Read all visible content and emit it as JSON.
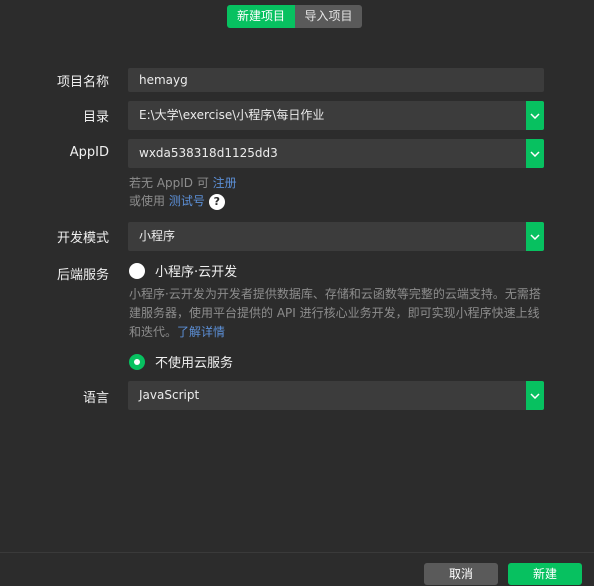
{
  "tabs": {
    "new_project": "新建项目",
    "import_project": "导入项目"
  },
  "form": {
    "project_name": {
      "label": "项目名称",
      "value": "hemayg"
    },
    "directory": {
      "label": "目录",
      "value": "E:\\大学\\exercise\\小程序\\每日作业"
    },
    "appid": {
      "label": "AppID",
      "value": "wxda538318d1125dd3",
      "hint_prefix": "若无 AppID 可 ",
      "hint_register": "注册",
      "hint2_prefix": "或使用 ",
      "hint2_test": "测试号",
      "help": "?"
    },
    "dev_mode": {
      "label": "开发模式",
      "value": "小程序"
    },
    "backend": {
      "label": "后端服务",
      "option_cloud": "小程序·云开发",
      "cloud_desc": "小程序·云开发为开发者提供数据库、存储和云函数等完整的云端支持。无需搭建服务器，使用平台提供的 API 进行核心业务开发，即可实现小程序快速上线和迭代。",
      "learn_more": "了解详情",
      "option_none": "不使用云服务",
      "selected": "option_none"
    },
    "language": {
      "label": "语言",
      "value": "JavaScript"
    }
  },
  "footer": {
    "cancel": "取消",
    "create": "新建"
  },
  "colors": {
    "accent": "#07c160",
    "background": "#2c2c2c",
    "input": "#3c3c3c",
    "link": "#5c8fd6"
  }
}
